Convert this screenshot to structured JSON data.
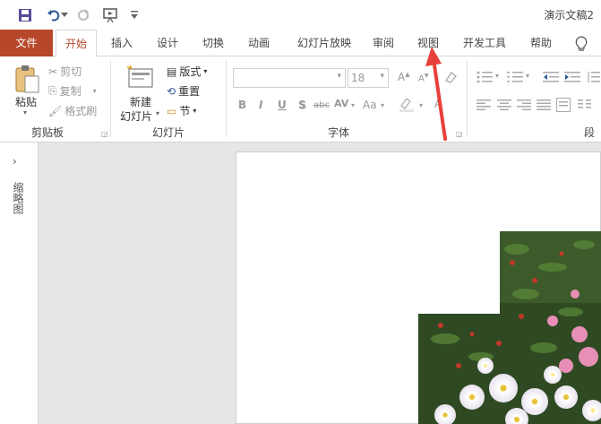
{
  "qat": {
    "title": "演示文稿2"
  },
  "tabs": [
    {
      "label": "文件"
    },
    {
      "label": "开始"
    },
    {
      "label": "插入"
    },
    {
      "label": "设计"
    },
    {
      "label": "切换"
    },
    {
      "label": "动画"
    },
    {
      "label": "幻灯片放映"
    },
    {
      "label": "审阅"
    },
    {
      "label": "视图"
    },
    {
      "label": "开发工具"
    },
    {
      "label": "帮助"
    }
  ],
  "ribbon": {
    "clipboard": {
      "paste": "粘贴",
      "cut": "剪切",
      "copy": "复制",
      "format_painter": "格式刷",
      "label": "剪贴板"
    },
    "slides": {
      "new_slide_line1": "新建",
      "new_slide_line2": "幻灯片",
      "layout": "版式",
      "reset": "重置",
      "section": "节",
      "label": "幻灯片"
    },
    "font": {
      "font_name": "",
      "font_size": "18",
      "label": "字体"
    },
    "paragraph": {
      "label": "段落"
    }
  },
  "thumbpane": {
    "label": "缩略图"
  },
  "colors": {
    "accent": "#b7472a",
    "annotation_arrow": "#e8403a"
  }
}
